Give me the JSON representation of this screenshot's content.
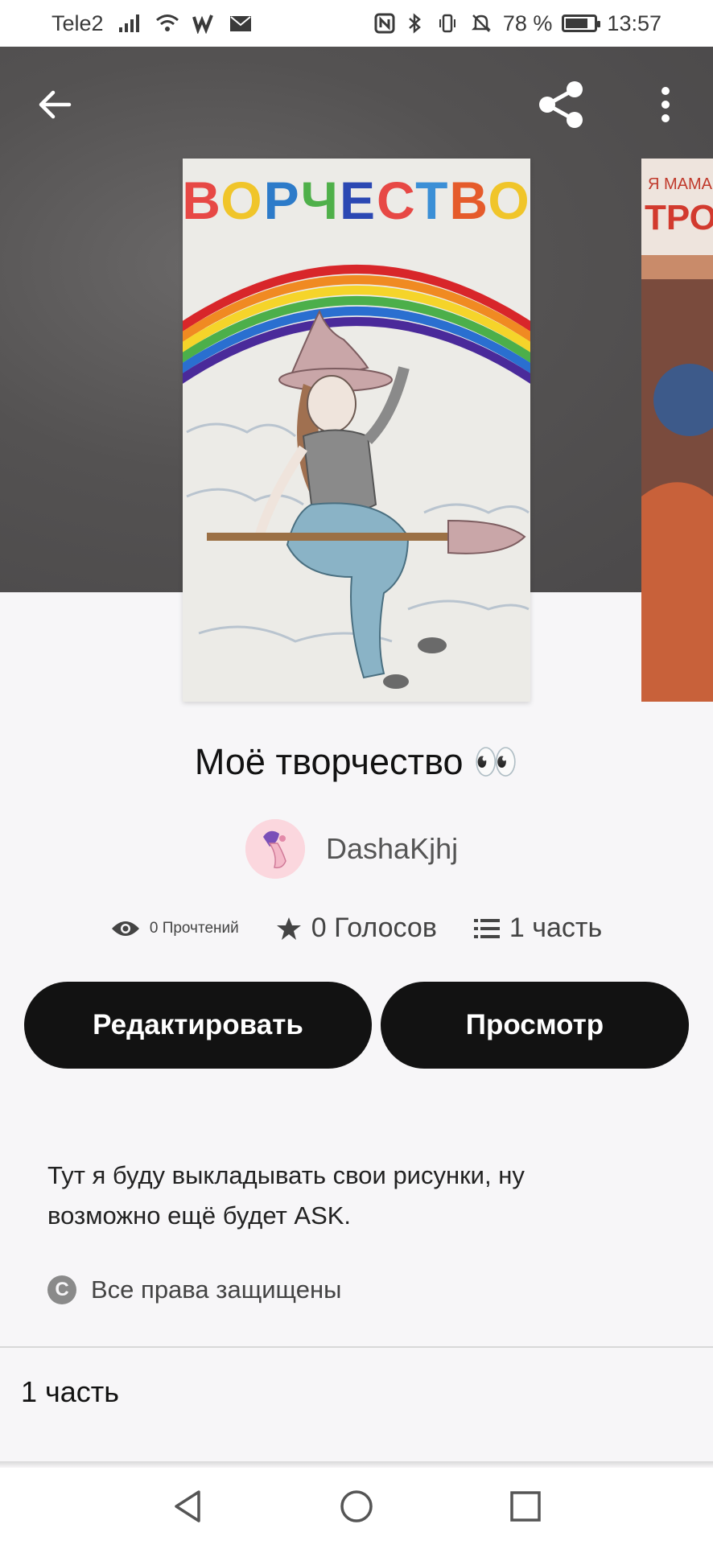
{
  "status_bar": {
    "carrier": "Tele2",
    "battery_percent": "78 %",
    "battery_level": 0.78,
    "time": "13:57",
    "icons": [
      "signal-icon",
      "wifi-icon",
      "w-app-icon",
      "mail-icon",
      "nfc-icon",
      "bluetooth-icon",
      "vibrate-icon",
      "mute-icon",
      "battery-icon"
    ]
  },
  "toolbar": {
    "back_icon": "arrow-left-icon",
    "share_icon": "share-icon",
    "more_icon": "more-vertical-icon"
  },
  "cover": {
    "lettering": "ВОРЧЕСТВО",
    "next_cover_lettering": "Я МАМА ТРОГА"
  },
  "story": {
    "title": "Моё творчество 👀",
    "author": "DashaKjhj",
    "reads": "0 Прочтений",
    "votes": "0 Голосов",
    "parts": "1 часть",
    "description": "Тут я буду выкладывать свои рисунки, ну возможно ещё будет ASK.",
    "rights": "Все права защищены"
  },
  "actions": {
    "edit_label": "Редактировать",
    "view_label": "Просмотр"
  },
  "parts_list": [
    {
      "label": "1 часть"
    }
  ],
  "colors": {
    "button_bg": "#121212",
    "button_text": "#ffffff",
    "page_bg": "#f7f6f8",
    "hero_bg": "#525051"
  }
}
